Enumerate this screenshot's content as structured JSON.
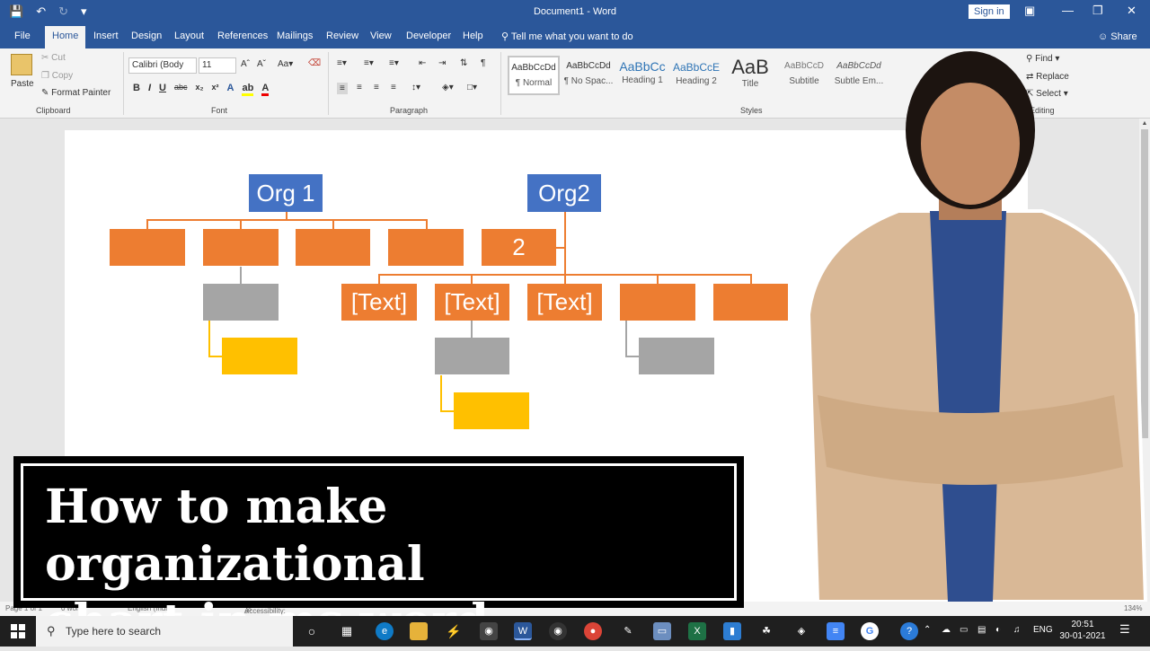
{
  "titlebar": {
    "title": "Document1  -  Word",
    "signin": "Sign in"
  },
  "tabs": {
    "file": "File",
    "home": "Home",
    "insert": "Insert",
    "design": "Design",
    "layout": "Layout",
    "references": "References",
    "mailings": "Mailings",
    "review": "Review",
    "view": "View",
    "developer": "Developer",
    "help": "Help",
    "tellme": "Tell me what you want to do",
    "share": "Share"
  },
  "ribbon": {
    "clipboard": {
      "paste": "Paste",
      "cut": "Cut",
      "copy": "Copy",
      "format_painter": "Format Painter",
      "label": "Clipboard"
    },
    "font": {
      "name": "Calibri (Body",
      "size": "11",
      "label": "Font"
    },
    "paragraph": {
      "label": "Paragraph"
    },
    "styles": {
      "label": "Styles",
      "items": [
        {
          "preview": "AaBbCcDd",
          "name": "¶ Normal"
        },
        {
          "preview": "AaBbCcDd",
          "name": "¶ No Spac..."
        },
        {
          "preview": "AaBbCc",
          "name": "Heading 1"
        },
        {
          "preview": "AaBbCcE",
          "name": "Heading 2"
        },
        {
          "preview": "AaB",
          "name": "Title"
        },
        {
          "preview": "AaBbCcD",
          "name": "Subtitle"
        },
        {
          "preview": "AaBbCcDd",
          "name": "Subtle Em..."
        }
      ]
    },
    "editing": {
      "find": "Find",
      "replace": "Replace",
      "select": "Select",
      "label": "Editing"
    }
  },
  "chart": {
    "org1": "Org 1",
    "org2": "Org2",
    "num": "2",
    "text": "[Text]"
  },
  "statusbar": {
    "page": "Page 1 of 1",
    "words": "0 words",
    "lang": "English (India)",
    "access": "Accessibility: Investigate",
    "zoom": "134%"
  },
  "banner": {
    "line1": "How to make organizational",
    "line2": "chart in ms word"
  },
  "taskbar": {
    "search": "Type here to search",
    "lang": "ENG",
    "time": "20:51",
    "date": "30-01-2021"
  },
  "colors": {
    "word_blue": "#2b579a",
    "node_blue": "#4472c4",
    "node_orange": "#ed7d31",
    "node_gray": "#a5a5a5",
    "node_gold": "#ffc000"
  }
}
